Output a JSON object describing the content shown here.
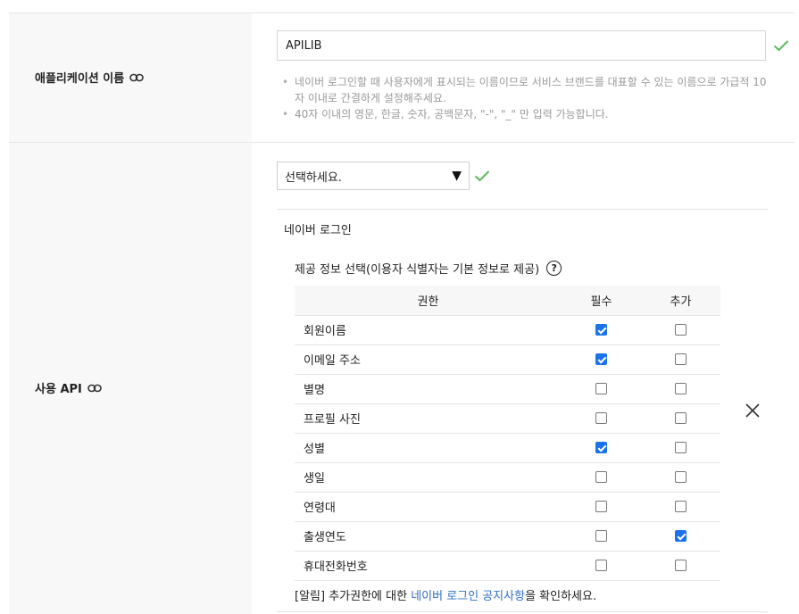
{
  "app_name_field": {
    "label": "애플리케이션 이름",
    "value": "APILIB",
    "hints": [
      "네이버 로그인할 때 사용자에게 표시되는 이름이므로 서비스 브랜드를 대표할 수 있는 이름으로 가급적 10자 이내로 간결하게 설정해주세요.",
      "40자 이내의 영문, 한글, 숫자, 공백문자, \"-\", \"_\" 만 입력 가능합니다."
    ],
    "valid_icon": "check-icon",
    "link_icon": "link-icon"
  },
  "api_field": {
    "label": "사용 API",
    "select_value": "선택하세요.",
    "valid_icon": "check-icon",
    "link_icon": "link-icon"
  },
  "naver_login": {
    "title": "네이버 로그인",
    "provide_title": "제공 정보 선택(이용자 식별자는 기본 정보로 제공)",
    "help_symbol": "?",
    "table": {
      "headers": {
        "permission": "권한",
        "required": "필수",
        "additional": "추가"
      },
      "rows": [
        {
          "name": "회원이름",
          "required": true,
          "additional": false
        },
        {
          "name": "이메일 주소",
          "required": true,
          "additional": false
        },
        {
          "name": "별명",
          "required": false,
          "additional": false
        },
        {
          "name": "프로필 사진",
          "required": false,
          "additional": false
        },
        {
          "name": "성별",
          "required": true,
          "additional": false
        },
        {
          "name": "생일",
          "required": false,
          "additional": false
        },
        {
          "name": "연령대",
          "required": false,
          "additional": false
        },
        {
          "name": "출생연도",
          "required": false,
          "additional": true
        },
        {
          "name": "휴대전화번호",
          "required": false,
          "additional": false
        }
      ]
    },
    "notice_prefix": "[알림] 추가권한에 대한 ",
    "notice_link": "네이버 로그인 공지사항",
    "notice_suffix": "을 확인하세요.",
    "remove_icon": "close-icon"
  },
  "colors": {
    "check_green": "#5cb85c",
    "checkbox_blue": "#1a73e8",
    "link_blue": "#2f6fc4",
    "label_bg": "#f8f8f8"
  }
}
